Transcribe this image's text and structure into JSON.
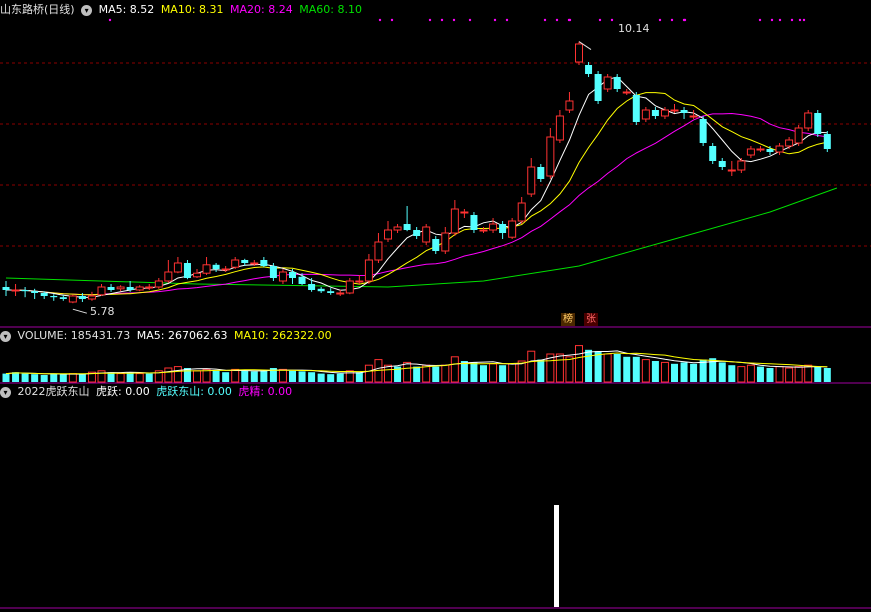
{
  "colors": {
    "up": "#ff3232",
    "down": "#54ffff",
    "ma5": "#ffffff",
    "ma10": "#ffff00",
    "ma20": "#ff00ff",
    "ma60": "#00e000",
    "grid": "#8b0000",
    "divider": "#a000a0"
  },
  "main": {
    "stock_name": "山东路桥(日线)",
    "ma5_label": "MA5: 8.52",
    "ma10_label": "MA10: 8.31",
    "ma20_label": "MA20: 8.24",
    "ma60_label": "MA60: 8.10",
    "high_label": "10.14",
    "low_label": "5.78",
    "badge_bang": "榜",
    "badge_zhang": "张"
  },
  "volume": {
    "title": "VOLUME: 185431.73",
    "ma5_label": "MA5: 267062.63",
    "ma10_label": "MA10: 262322.00"
  },
  "indicator": {
    "name": "2022虎跃东山",
    "huyue_label": "虎跃: 0.00",
    "huyuedongshan_label": "虎跃东山: 0.00",
    "hujing_label": "虎精: 0.00"
  },
  "chart_data": {
    "type": "candlestick",
    "ylim": [
      5.5,
      10.5
    ],
    "candles": [
      {
        "o": 6.05,
        "c": 6.0,
        "h": 6.15,
        "l": 5.9
      },
      {
        "o": 6.0,
        "c": 6.0,
        "h": 6.1,
        "l": 5.9
      },
      {
        "o": 6.0,
        "c": 5.98,
        "h": 6.05,
        "l": 5.88
      },
      {
        "o": 5.98,
        "c": 5.95,
        "h": 6.02,
        "l": 5.85
      },
      {
        "o": 5.95,
        "c": 5.9,
        "h": 5.98,
        "l": 5.85
      },
      {
        "o": 5.9,
        "c": 5.88,
        "h": 5.93,
        "l": 5.82
      },
      {
        "o": 5.88,
        "c": 5.85,
        "h": 5.92,
        "l": 5.82
      },
      {
        "o": 5.8,
        "c": 5.9,
        "h": 5.92,
        "l": 5.78
      },
      {
        "o": 5.9,
        "c": 5.85,
        "h": 5.95,
        "l": 5.8
      },
      {
        "o": 5.85,
        "c": 5.9,
        "h": 5.97,
        "l": 5.82
      },
      {
        "o": 5.92,
        "c": 6.05,
        "h": 6.1,
        "l": 5.9
      },
      {
        "o": 6.05,
        "c": 6.0,
        "h": 6.1,
        "l": 5.97
      },
      {
        "o": 6.02,
        "c": 6.05,
        "h": 6.08,
        "l": 5.98
      },
      {
        "o": 6.05,
        "c": 6.0,
        "h": 6.15,
        "l": 5.97
      },
      {
        "o": 6.0,
        "c": 6.05,
        "h": 6.08,
        "l": 5.98
      },
      {
        "o": 6.05,
        "c": 6.05,
        "h": 6.1,
        "l": 6.0
      },
      {
        "o": 6.05,
        "c": 6.15,
        "h": 6.2,
        "l": 6.02
      },
      {
        "o": 6.15,
        "c": 6.3,
        "h": 6.5,
        "l": 6.12
      },
      {
        "o": 6.3,
        "c": 6.45,
        "h": 6.55,
        "l": 6.28
      },
      {
        "o": 6.45,
        "c": 6.2,
        "h": 6.5,
        "l": 6.18
      },
      {
        "o": 6.22,
        "c": 6.28,
        "h": 6.35,
        "l": 6.2
      },
      {
        "o": 6.28,
        "c": 6.42,
        "h": 6.55,
        "l": 6.25
      },
      {
        "o": 6.42,
        "c": 6.35,
        "h": 6.45,
        "l": 6.3
      },
      {
        "o": 6.35,
        "c": 6.35,
        "h": 6.4,
        "l": 6.3
      },
      {
        "o": 6.38,
        "c": 6.5,
        "h": 6.55,
        "l": 6.35
      },
      {
        "o": 6.5,
        "c": 6.45,
        "h": 6.52,
        "l": 6.4
      },
      {
        "o": 6.45,
        "c": 6.45,
        "h": 6.5,
        "l": 6.4
      },
      {
        "o": 6.5,
        "c": 6.4,
        "h": 6.55,
        "l": 6.38
      },
      {
        "o": 6.4,
        "c": 6.2,
        "h": 6.45,
        "l": 6.15
      },
      {
        "o": 6.15,
        "c": 6.3,
        "h": 6.35,
        "l": 6.1
      },
      {
        "o": 6.3,
        "c": 6.2,
        "h": 6.35,
        "l": 6.1
      },
      {
        "o": 6.22,
        "c": 6.1,
        "h": 6.28,
        "l": 6.08
      },
      {
        "o": 6.1,
        "c": 6.0,
        "h": 6.2,
        "l": 5.97
      },
      {
        "o": 6.02,
        "c": 5.98,
        "h": 6.05,
        "l": 5.95
      },
      {
        "o": 5.98,
        "c": 5.95,
        "h": 6.03,
        "l": 5.92
      },
      {
        "o": 5.95,
        "c": 5.95,
        "h": 6.0,
        "l": 5.9
      },
      {
        "o": 5.95,
        "c": 6.15,
        "h": 6.2,
        "l": 5.93
      },
      {
        "o": 6.15,
        "c": 6.15,
        "h": 6.25,
        "l": 6.1
      },
      {
        "o": 6.15,
        "c": 6.5,
        "h": 6.6,
        "l": 6.1
      },
      {
        "o": 6.5,
        "c": 6.8,
        "h": 6.95,
        "l": 6.45
      },
      {
        "o": 6.85,
        "c": 7.0,
        "h": 7.15,
        "l": 6.8
      },
      {
        "o": 7.0,
        "c": 7.05,
        "h": 7.1,
        "l": 6.95
      },
      {
        "o": 7.1,
        "c": 7.0,
        "h": 7.4,
        "l": 6.98
      },
      {
        "o": 7.0,
        "c": 6.9,
        "h": 7.05,
        "l": 6.85
      },
      {
        "o": 6.8,
        "c": 7.05,
        "h": 7.1,
        "l": 6.75
      },
      {
        "o": 6.85,
        "c": 6.65,
        "h": 6.9,
        "l": 6.6
      },
      {
        "o": 6.65,
        "c": 6.95,
        "h": 7.05,
        "l": 6.6
      },
      {
        "o": 6.95,
        "c": 7.35,
        "h": 7.5,
        "l": 6.9
      },
      {
        "o": 7.3,
        "c": 7.3,
        "h": 7.35,
        "l": 7.2
      },
      {
        "o": 7.25,
        "c": 7.0,
        "h": 7.3,
        "l": 6.95
      },
      {
        "o": 7.0,
        "c": 7.0,
        "h": 7.05,
        "l": 6.95
      },
      {
        "o": 7.0,
        "c": 7.1,
        "h": 7.2,
        "l": 6.95
      },
      {
        "o": 7.1,
        "c": 6.95,
        "h": 7.15,
        "l": 6.85
      },
      {
        "o": 6.88,
        "c": 7.15,
        "h": 7.2,
        "l": 6.85
      },
      {
        "o": 7.15,
        "c": 7.45,
        "h": 7.55,
        "l": 7.1
      },
      {
        "o": 7.6,
        "c": 8.05,
        "h": 8.2,
        "l": 7.55
      },
      {
        "o": 8.05,
        "c": 7.85,
        "h": 8.1,
        "l": 7.8
      },
      {
        "o": 7.9,
        "c": 8.55,
        "h": 8.7,
        "l": 7.85
      },
      {
        "o": 8.5,
        "c": 8.9,
        "h": 9.0,
        "l": 8.45
      },
      {
        "o": 9.0,
        "c": 9.15,
        "h": 9.3,
        "l": 8.95
      },
      {
        "o": 9.8,
        "c": 10.1,
        "h": 10.14,
        "l": 9.75
      },
      {
        "o": 9.75,
        "c": 9.6,
        "h": 9.8,
        "l": 9.55
      },
      {
        "o": 9.6,
        "c": 9.15,
        "h": 9.65,
        "l": 9.1
      },
      {
        "o": 9.35,
        "c": 9.55,
        "h": 9.6,
        "l": 9.3
      },
      {
        "o": 9.55,
        "c": 9.35,
        "h": 9.6,
        "l": 9.3
      },
      {
        "o": 9.3,
        "c": 9.3,
        "h": 9.35,
        "l": 9.25
      },
      {
        "o": 9.25,
        "c": 8.8,
        "h": 9.3,
        "l": 8.75
      },
      {
        "o": 8.85,
        "c": 9.0,
        "h": 9.05,
        "l": 8.8
      },
      {
        "o": 9.0,
        "c": 8.9,
        "h": 9.05,
        "l": 8.85
      },
      {
        "o": 8.9,
        "c": 9.0,
        "h": 9.05,
        "l": 8.85
      },
      {
        "o": 9.0,
        "c": 9.0,
        "h": 9.1,
        "l": 8.95
      },
      {
        "o": 9.0,
        "c": 8.95,
        "h": 9.05,
        "l": 8.85
      },
      {
        "o": 8.9,
        "c": 8.9,
        "h": 9.0,
        "l": 8.85
      },
      {
        "o": 8.85,
        "c": 8.45,
        "h": 8.9,
        "l": 8.4
      },
      {
        "o": 8.4,
        "c": 8.15,
        "h": 8.45,
        "l": 8.1
      },
      {
        "o": 8.15,
        "c": 8.05,
        "h": 8.2,
        "l": 8.0
      },
      {
        "o": 8.0,
        "c": 8.0,
        "h": 8.15,
        "l": 7.9
      },
      {
        "o": 8.0,
        "c": 8.15,
        "h": 8.2,
        "l": 7.95
      },
      {
        "o": 8.25,
        "c": 8.35,
        "h": 8.4,
        "l": 8.2
      },
      {
        "o": 8.35,
        "c": 8.35,
        "h": 8.4,
        "l": 8.3
      },
      {
        "o": 8.35,
        "c": 8.3,
        "h": 8.4,
        "l": 8.25
      },
      {
        "o": 8.3,
        "c": 8.4,
        "h": 8.45,
        "l": 8.25
      },
      {
        "o": 8.4,
        "c": 8.5,
        "h": 8.55,
        "l": 8.35
      },
      {
        "o": 8.45,
        "c": 8.7,
        "h": 8.75,
        "l": 8.4
      },
      {
        "o": 8.7,
        "c": 8.95,
        "h": 9.0,
        "l": 8.65
      },
      {
        "o": 8.95,
        "c": 8.6,
        "h": 9.0,
        "l": 8.55
      },
      {
        "o": 8.6,
        "c": 8.35,
        "h": 8.65,
        "l": 8.3
      }
    ],
    "ma60": [
      [
        0,
        6.2
      ],
      [
        20,
        6.1
      ],
      [
        40,
        6.05
      ],
      [
        50,
        6.15
      ],
      [
        60,
        6.4
      ],
      [
        70,
        6.85
      ],
      [
        80,
        7.3
      ],
      [
        87,
        7.7
      ]
    ],
    "volume": [
      {
        "v": 0.3,
        "up": false
      },
      {
        "v": 0.35,
        "up": false
      },
      {
        "v": 0.3,
        "up": false
      },
      {
        "v": 0.28,
        "up": false
      },
      {
        "v": 0.25,
        "up": false
      },
      {
        "v": 0.3,
        "up": false
      },
      {
        "v": 0.28,
        "up": false
      },
      {
        "v": 0.3,
        "up": true
      },
      {
        "v": 0.28,
        "up": false
      },
      {
        "v": 0.35,
        "up": true
      },
      {
        "v": 0.4,
        "up": true
      },
      {
        "v": 0.35,
        "up": false
      },
      {
        "v": 0.3,
        "up": true
      },
      {
        "v": 0.35,
        "up": false
      },
      {
        "v": 0.3,
        "up": true
      },
      {
        "v": 0.3,
        "up": false
      },
      {
        "v": 0.4,
        "up": true
      },
      {
        "v": 0.5,
        "up": true
      },
      {
        "v": 0.55,
        "up": true
      },
      {
        "v": 0.5,
        "up": false
      },
      {
        "v": 0.4,
        "up": true
      },
      {
        "v": 0.45,
        "up": true
      },
      {
        "v": 0.4,
        "up": false
      },
      {
        "v": 0.35,
        "up": false
      },
      {
        "v": 0.45,
        "up": true
      },
      {
        "v": 0.4,
        "up": false
      },
      {
        "v": 0.38,
        "up": false
      },
      {
        "v": 0.4,
        "up": false
      },
      {
        "v": 0.5,
        "up": false
      },
      {
        "v": 0.45,
        "up": true
      },
      {
        "v": 0.4,
        "up": false
      },
      {
        "v": 0.38,
        "up": false
      },
      {
        "v": 0.35,
        "up": false
      },
      {
        "v": 0.3,
        "up": false
      },
      {
        "v": 0.28,
        "up": false
      },
      {
        "v": 0.3,
        "up": false
      },
      {
        "v": 0.4,
        "up": true
      },
      {
        "v": 0.35,
        "up": false
      },
      {
        "v": 0.6,
        "up": true
      },
      {
        "v": 0.8,
        "up": true
      },
      {
        "v": 0.6,
        "up": true
      },
      {
        "v": 0.55,
        "up": false
      },
      {
        "v": 0.7,
        "up": true
      },
      {
        "v": 0.55,
        "up": false
      },
      {
        "v": 0.6,
        "up": true
      },
      {
        "v": 0.55,
        "up": false
      },
      {
        "v": 0.6,
        "up": true
      },
      {
        "v": 0.9,
        "up": true
      },
      {
        "v": 0.75,
        "up": false
      },
      {
        "v": 0.7,
        "up": false
      },
      {
        "v": 0.6,
        "up": false
      },
      {
        "v": 0.65,
        "up": true
      },
      {
        "v": 0.6,
        "up": false
      },
      {
        "v": 0.65,
        "up": true
      },
      {
        "v": 0.75,
        "up": true
      },
      {
        "v": 1.1,
        "up": true
      },
      {
        "v": 0.8,
        "up": false
      },
      {
        "v": 1.0,
        "up": true
      },
      {
        "v": 1.0,
        "up": true
      },
      {
        "v": 0.9,
        "up": true
      },
      {
        "v": 1.3,
        "up": true
      },
      {
        "v": 1.15,
        "up": false
      },
      {
        "v": 1.1,
        "up": false
      },
      {
        "v": 1.0,
        "up": true
      },
      {
        "v": 1.0,
        "up": false
      },
      {
        "v": 0.9,
        "up": false
      },
      {
        "v": 0.9,
        "up": false
      },
      {
        "v": 0.8,
        "up": true
      },
      {
        "v": 0.75,
        "up": false
      },
      {
        "v": 0.7,
        "up": true
      },
      {
        "v": 0.65,
        "up": false
      },
      {
        "v": 0.7,
        "up": false
      },
      {
        "v": 0.65,
        "up": false
      },
      {
        "v": 0.8,
        "up": false
      },
      {
        "v": 0.85,
        "up": false
      },
      {
        "v": 0.7,
        "up": false
      },
      {
        "v": 0.6,
        "up": false
      },
      {
        "v": 0.55,
        "up": true
      },
      {
        "v": 0.6,
        "up": true
      },
      {
        "v": 0.55,
        "up": false
      },
      {
        "v": 0.5,
        "up": false
      },
      {
        "v": 0.55,
        "up": true
      },
      {
        "v": 0.5,
        "up": true
      },
      {
        "v": 0.55,
        "up": true
      },
      {
        "v": 0.6,
        "up": true
      },
      {
        "v": 0.55,
        "up": false
      },
      {
        "v": 0.5,
        "up": false
      }
    ]
  }
}
